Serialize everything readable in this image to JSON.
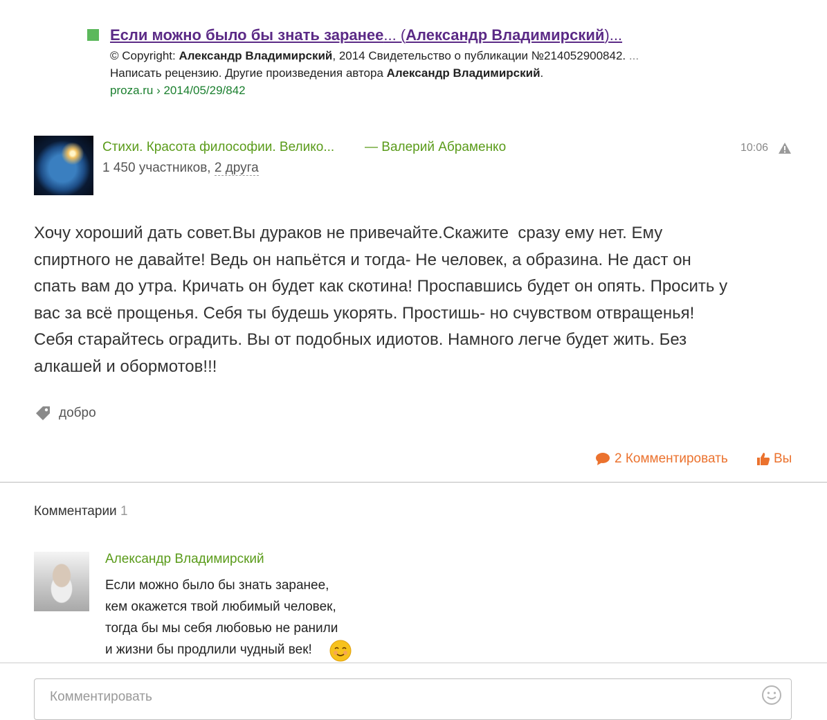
{
  "snippet": {
    "title_bold": "Если можно было бы знать заранее",
    "title_ellipsis1": "... (",
    "title_author": "Александр Владимирский",
    "title_ellipsis2": ")...",
    "line1_prefix": "© Copyright: ",
    "line1_author": "Александр Владимирский",
    "line1_suffix": ", 2014 Свидетельство о публикации №214052900842. ",
    "line1_more": "...",
    "line2_prefix": "Написать рецензию. Другие произведения автора ",
    "line2_author": "Александр Владимирский",
    "line2_suffix": ".",
    "url": "proza.ru › 2014/05/29/842"
  },
  "post": {
    "group_name": "Стихи. Красота философии. Велико...",
    "author": "— Валерий Абраменко",
    "members": "1 450 участников, ",
    "friends": "2 друга",
    "time": "10:06",
    "text": "Хочу хороший дать совет.Вы дураков не привечайте.Скажите  сразу ему нет. Ему\nспиртного не давайте! Ведь он напьётся и тогда- Не человек, а образина. Не даст он\nспать вам до утра. Кричать он будет как скотина! Проспавшись будет он опять. Просить у\nвас за всё прощенья. Себя ты будешь укорять. Простишь- но счувством отвращенья!\nСебя старайтесь оградить. Вы от подобных идиотов. Намного легче будет жить. Без\nалкашей и обормотов!!!",
    "tag": "добро",
    "comment_action": "2 Комментировать",
    "like_action": "Вы"
  },
  "comments": {
    "header": "Комментарии",
    "count": "1",
    "items": [
      {
        "author": "Александр Владимирский",
        "text": "Если можно было бы знать заранее,\nкем окажется твой любимый человек,\nтогда бы мы себя любовью не ранили\nи жизни бы продлили чудный век!"
      }
    ],
    "input_placeholder": "Комментировать"
  },
  "colors": {
    "link_green": "#5a9b1a",
    "action_orange": "#eb722e",
    "visited_purple": "#5b2a86"
  },
  "icons": [
    "alert-icon",
    "tag-icon",
    "comment-bubble-icon",
    "like-icon",
    "smile-emoji-icon",
    "emoji-button-icon"
  ]
}
